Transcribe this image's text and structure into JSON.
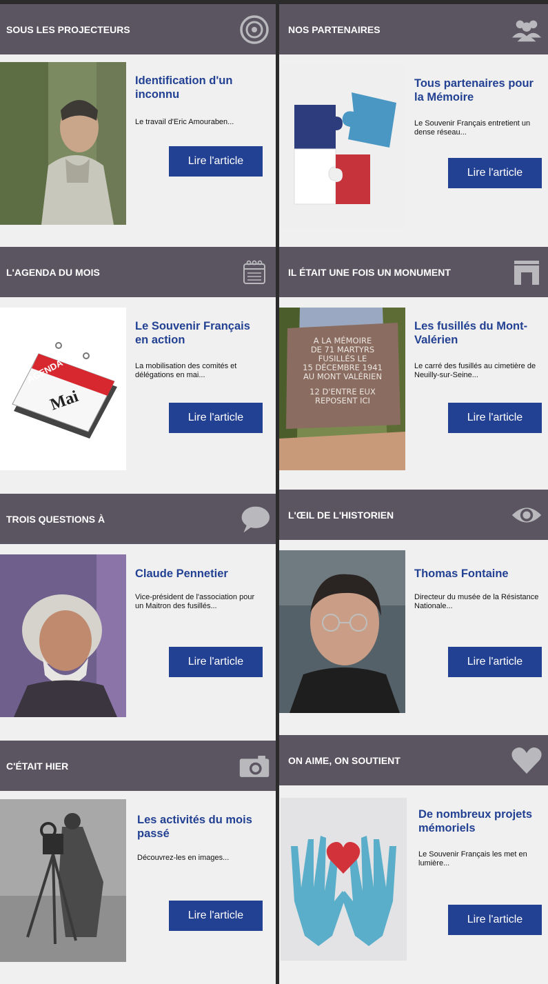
{
  "colors": {
    "header_bg": "#5b5562",
    "accent_blue": "#234193",
    "page_bg": "#f0f0f0",
    "divider": "#2b2b2b",
    "icon_gray": "#b9b9bd"
  },
  "sections": [
    {
      "header": "SOUS LES PROJECTEURS",
      "icon": "target-icon",
      "title": "Identification d'un inconnu",
      "description": "Le travail d'Eric Amouraben...",
      "button": "Lire l'article"
    },
    {
      "header": "NOS PARTENAIRES",
      "icon": "group-icon",
      "title": "Tous partenaires pour la Mémoire",
      "description": "Le Souvenir Français entretient un dense réseau...",
      "button": "Lire l'article"
    },
    {
      "header": "L'AGENDA DU MOIS",
      "icon": "calendar-icon",
      "title": "Le Souvenir Français en action",
      "description": "La mobilisation des comités et délégations en mai...",
      "button": "Lire l'article",
      "image_text": {
        "banner": "AGENDA",
        "month": "Mai"
      }
    },
    {
      "header": "IL ÉTAIT UNE FOIS  UN MONUMENT",
      "icon": "monument-icon",
      "title": "Les fusillés du Mont-Valérien",
      "description": "Le carré des fusillés au cimetière de Neuilly-sur-Seine...",
      "button": "Lire l'article",
      "image_text": {
        "l1": "A LA MÉMOIRE",
        "l2": "DE 71 MARTYRS",
        "l3": "FUSILLÉS LE",
        "l4": "15 DÉCEMBRE 1941",
        "l5": "AU MONT VALÉRIEN",
        "l6": "12 D'ENTRE EUX",
        "l7": "REPOSENT ICI"
      }
    },
    {
      "header": "TROIS QUESTIONS À",
      "icon": "speech-bubble-icon",
      "title": "Claude Pennetier",
      "description": "Vice-président de l'association pour un Maitron des fusillés...",
      "button": "Lire l'article"
    },
    {
      "header": "L'ŒIL DE L'HISTORIEN",
      "icon": "eye-icon",
      "title": "Thomas Fontaine",
      "description": "Directeur du musée de la Résistance Nationale...",
      "button": "Lire l'article"
    },
    {
      "header": "C'ÉTAIT HIER",
      "icon": "camera-icon",
      "title": "Les activités du mois passé",
      "description": "Découvrez-les en images...",
      "button": "Lire l'article"
    },
    {
      "header": "ON AIME, ON SOUTIENT",
      "icon": "heart-icon",
      "title": "De nombreux projets mémoriels",
      "description": "Le Souvenir Français les met en lumière...",
      "button": "Lire l'article"
    }
  ]
}
